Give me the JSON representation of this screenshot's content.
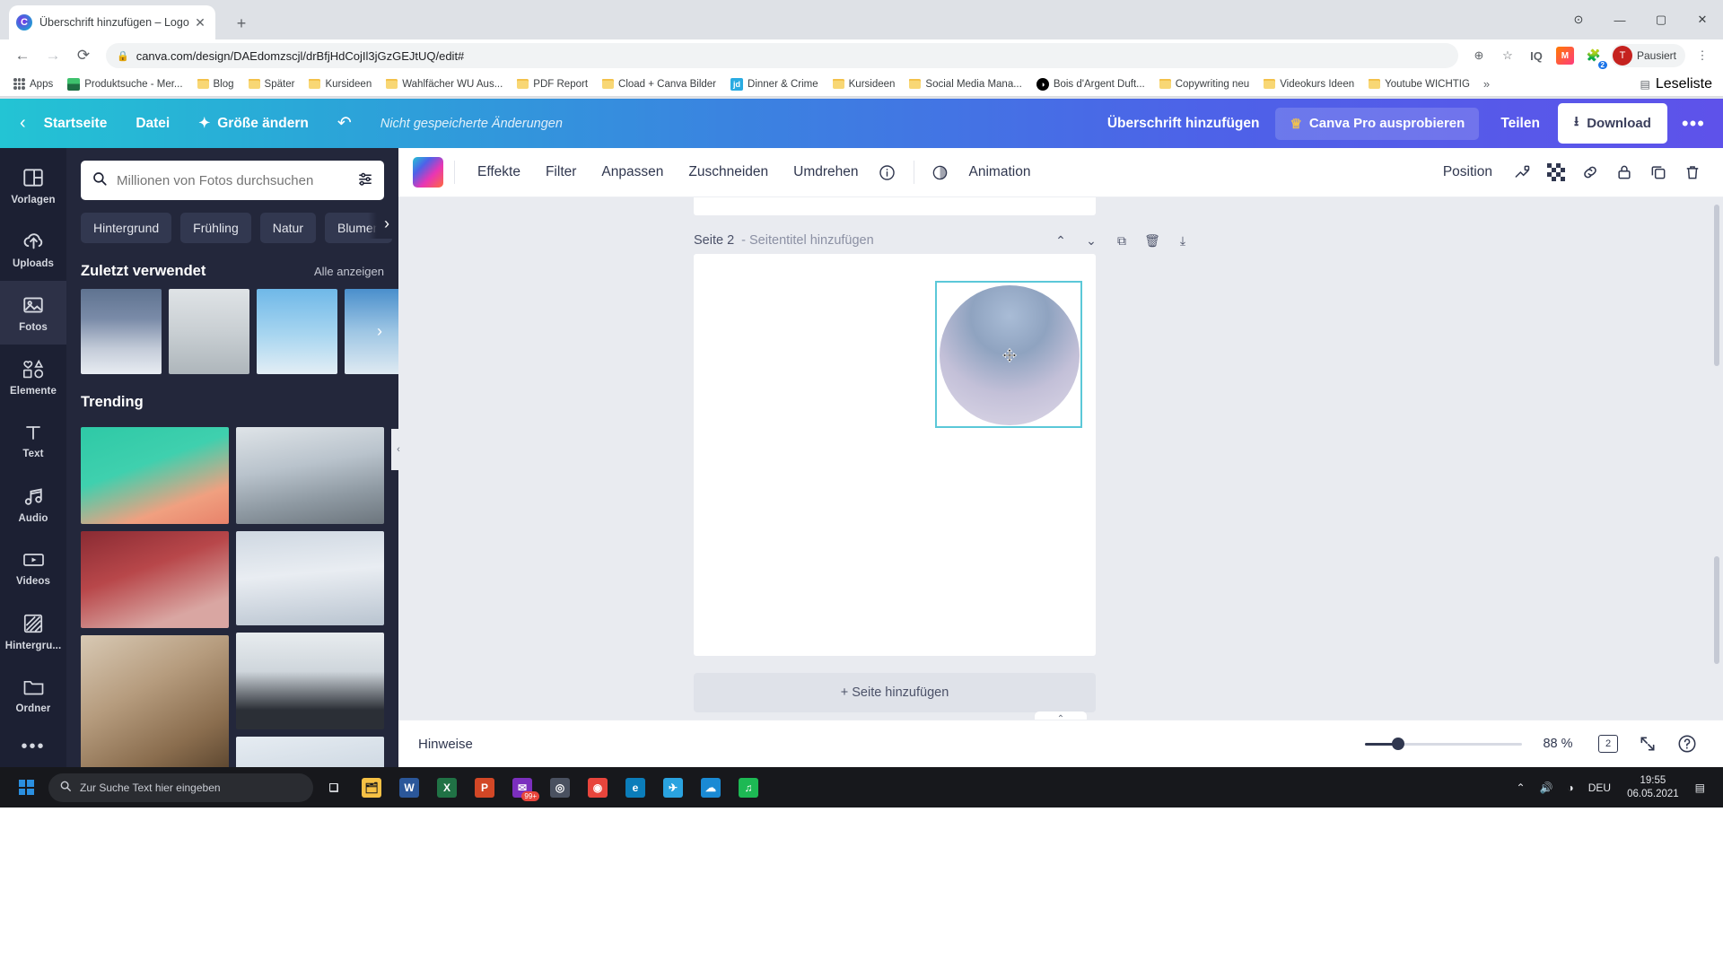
{
  "browser": {
    "tab_title": "Überschrift hinzufügen – Logo",
    "tab_close": "✕",
    "new_tab": "+",
    "win_minimize": "—",
    "win_maximize": "▢",
    "win_close": "✕",
    "win_extra": "⊙",
    "back": "←",
    "forward": "→",
    "reload": "⟳",
    "lock": "🔒",
    "url": "canva.com/design/DAEdomzscjl/drBfjHdCojIl3jGzGEJtUQ/edit#",
    "zoom_icon": "⊕",
    "star_icon": "☆",
    "ext_iq": "IQ",
    "ext_m": "M",
    "ext_badge": "2",
    "profile_name": "Pausiert",
    "profile_initial": "T",
    "chrome_menu": "⋮",
    "bookmarks": [
      {
        "label": "Apps",
        "icon": "apps-grid"
      },
      {
        "label": "Produktsuche - Mer...",
        "icon": "product-icon"
      },
      {
        "label": "Blog",
        "icon": "folder"
      },
      {
        "label": "Später",
        "icon": "folder"
      },
      {
        "label": "Kursideen",
        "icon": "folder"
      },
      {
        "label": "Wahlfächer WU Aus...",
        "icon": "folder"
      },
      {
        "label": "PDF Report",
        "icon": "folder"
      },
      {
        "label": "Cload + Canva Bilder",
        "icon": "folder"
      },
      {
        "label": "Dinner & Crime",
        "icon": "jd-icon"
      },
      {
        "label": "Kursideen",
        "icon": "folder"
      },
      {
        "label": "Social Media Mana...",
        "icon": "folder"
      },
      {
        "label": "Bois d'Argent Duft...",
        "icon": "bo-icon"
      },
      {
        "label": "Copywriting neu",
        "icon": "folder"
      },
      {
        "label": "Videokurs Ideen",
        "icon": "folder"
      },
      {
        "label": "Youtube WICHTIG",
        "icon": "folder"
      }
    ],
    "bookmarks_overflow": "»",
    "reading_list": "Leseliste"
  },
  "canva_header": {
    "back_arrow": "‹",
    "home": "Startseite",
    "file": "Datei",
    "resize": "Größe ändern",
    "resize_icon": "✦",
    "undo_icon": "↶",
    "unsaved": "Nicht gespeicherte Änderungen",
    "design_title": "Überschrift hinzufügen",
    "pro_label": "Canva Pro ausprobieren",
    "pro_icon": "♕",
    "share": "Teilen",
    "download": "Download",
    "download_icon": "⭳",
    "more": "•••"
  },
  "sidebar": {
    "items": [
      {
        "label": "Vorlagen",
        "icon": "templates-icon",
        "active": false
      },
      {
        "label": "Uploads",
        "icon": "upload-cloud-icon",
        "active": false
      },
      {
        "label": "Fotos",
        "icon": "photo-icon",
        "active": true
      },
      {
        "label": "Elemente",
        "icon": "elements-icon",
        "active": false
      },
      {
        "label": "Text",
        "icon": "text-icon",
        "active": false
      },
      {
        "label": "Audio",
        "icon": "audio-icon",
        "active": false
      },
      {
        "label": "Videos",
        "icon": "video-icon",
        "active": false
      },
      {
        "label": "Hintergru...",
        "icon": "background-icon",
        "active": false
      },
      {
        "label": "Ordner",
        "icon": "folder-icon",
        "active": false
      }
    ],
    "more": "•••"
  },
  "panel": {
    "search_placeholder": "Millionen von Fotos durchsuchen",
    "search_value": "",
    "search_icon": "search-icon",
    "filter_icon": "filter-sliders-icon",
    "chips": [
      "Hintergrund",
      "Frühling",
      "Natur",
      "Blumen"
    ],
    "chips_next": "›",
    "recent_title": "Zuletzt verwendet",
    "recent_show_all": "Alle anzeigen",
    "recent_next": "›",
    "trending_title": "Trending",
    "collapse_handle": "‹"
  },
  "editor_toolbar": {
    "color_swatch": "color-gradient-swatch",
    "effects": "Effekte",
    "filter": "Filter",
    "adjust": "Anpassen",
    "crop": "Zuschneiden",
    "flip": "Umdrehen",
    "info_icon": "ⓘ",
    "animation": "Animation",
    "animation_icon": "animation-icon",
    "position": "Position",
    "icons": [
      "copy-style-icon",
      "transparency-icon",
      "link-icon",
      "lock-icon",
      "duplicate-icon",
      "delete-icon"
    ]
  },
  "canvas": {
    "page_label": "Seite 2",
    "page_title_placeholder": "- Seitentitel hinzufügen",
    "move_up_icon": "⌃",
    "move_down_icon": "⌄",
    "duplicate_icon": "⧉",
    "delete_icon": "🗑",
    "export_icon": "⤓",
    "add_page": "+ Seite hinzufügen"
  },
  "bottom_bar": {
    "notes": "Hinweise",
    "zoom_percent": "88 %",
    "page_count": "2",
    "fullscreen_icon": "⤢",
    "help_icon": "?",
    "collapse_icon": "⌃"
  },
  "taskbar": {
    "start_icon": "windows-icon",
    "search_placeholder": "Zur Suche Text hier eingeben",
    "search_icon": "🔍",
    "apps": [
      {
        "name": "task-view-icon",
        "glyph": "❑",
        "color": "transparent",
        "text": "#e5e7eb"
      },
      {
        "name": "file-explorer-icon",
        "glyph": "🗂",
        "color": "#f6c144",
        "text": "#17181c"
      },
      {
        "name": "word-icon",
        "glyph": "W",
        "color": "#2b579a",
        "text": "#ffffff"
      },
      {
        "name": "excel-icon",
        "glyph": "X",
        "color": "#207245",
        "text": "#ffffff"
      },
      {
        "name": "powerpoint-icon",
        "glyph": "P",
        "color": "#d24726",
        "text": "#ffffff"
      },
      {
        "name": "mail-icon",
        "glyph": "✉",
        "color": "#7b2fbe",
        "text": "#ffffff",
        "badge": "99+"
      },
      {
        "name": "disc-icon",
        "glyph": "◎",
        "color": "#4a5160",
        "text": "#ffffff"
      },
      {
        "name": "chrome-icon",
        "glyph": "◉",
        "color": "#e8453c",
        "text": "#ffffff"
      },
      {
        "name": "edge-icon",
        "glyph": "e",
        "color": "#0b7dba",
        "text": "#ffffff"
      },
      {
        "name": "telegram-icon",
        "glyph": "✈",
        "color": "#2aa3e0",
        "text": "#ffffff"
      },
      {
        "name": "onedrive-icon",
        "glyph": "☁",
        "color": "#1a8ad4",
        "text": "#ffffff"
      },
      {
        "name": "spotify-icon",
        "glyph": "♫",
        "color": "#1db954",
        "text": "#ffffff"
      }
    ],
    "tray_up": "⌃",
    "tray_volume": "🔊",
    "tray_network": "◑",
    "tray_lang": "DEU",
    "time": "19:55",
    "date": "06.05.2021",
    "notification_icon": "▤"
  },
  "colors": {
    "canva_brand_start": "#23c4d4",
    "canva_brand_end": "#5e52ea",
    "selection_border": "#5bc8d8",
    "panel_bg": "#23273b",
    "rail_bg": "#1c2033"
  }
}
